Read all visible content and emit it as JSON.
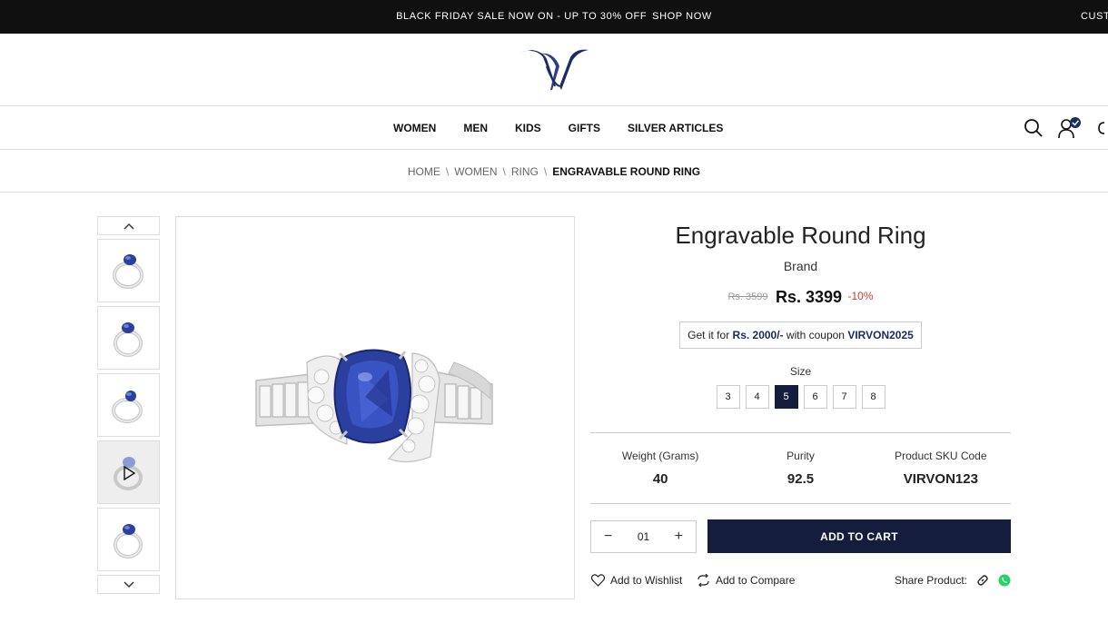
{
  "topbar": {
    "promo": "BLACK FRIDAY SALE NOW ON - UP TO  30% OFF",
    "promo_link": "SHOP NOW",
    "customer_label": "CUSTO"
  },
  "nav": {
    "items": [
      {
        "label": "WOMEN"
      },
      {
        "label": "MEN"
      },
      {
        "label": "KIDS"
      },
      {
        "label": "GIFTS"
      },
      {
        "label": "SILVER ARTICLES"
      }
    ]
  },
  "breadcrumb": {
    "items": [
      "HOME",
      "WOMEN",
      "RING"
    ],
    "separator": "\\",
    "current": "ENGRAVABLE ROUND RING"
  },
  "product": {
    "title": "Engravable Round Ring",
    "brand": "Brand",
    "old_price": "Rs. 3599",
    "price": "Rs. 3399",
    "discount": "-10%",
    "coupon_prefix": "Get it for",
    "coupon_price": "Rs. 2000/-",
    "coupon_mid": "with coupon",
    "coupon_code": "VIRVON2025",
    "size_label": "Size",
    "sizes": [
      "3",
      "4",
      "5",
      "6",
      "7",
      "8"
    ],
    "selected_size": "5",
    "specs": [
      {
        "label": "Weight (Grams)",
        "value": "40"
      },
      {
        "label": "Purity",
        "value": "92.5"
      },
      {
        "label": "Product SKU Code",
        "value": "VIRVON123"
      }
    ],
    "quantity": "01",
    "qty_minus": "−",
    "qty_plus": "+",
    "add_to_cart": "ADD TO CART",
    "wishlist": "Add to Wishlist",
    "compare": "Add to Compare",
    "share": "Share Product:"
  },
  "colors": {
    "navy": "#141e3c",
    "discount_red": "#d23a2a",
    "sapphire": "#2b3f9e",
    "whatsapp": "#25d366"
  }
}
